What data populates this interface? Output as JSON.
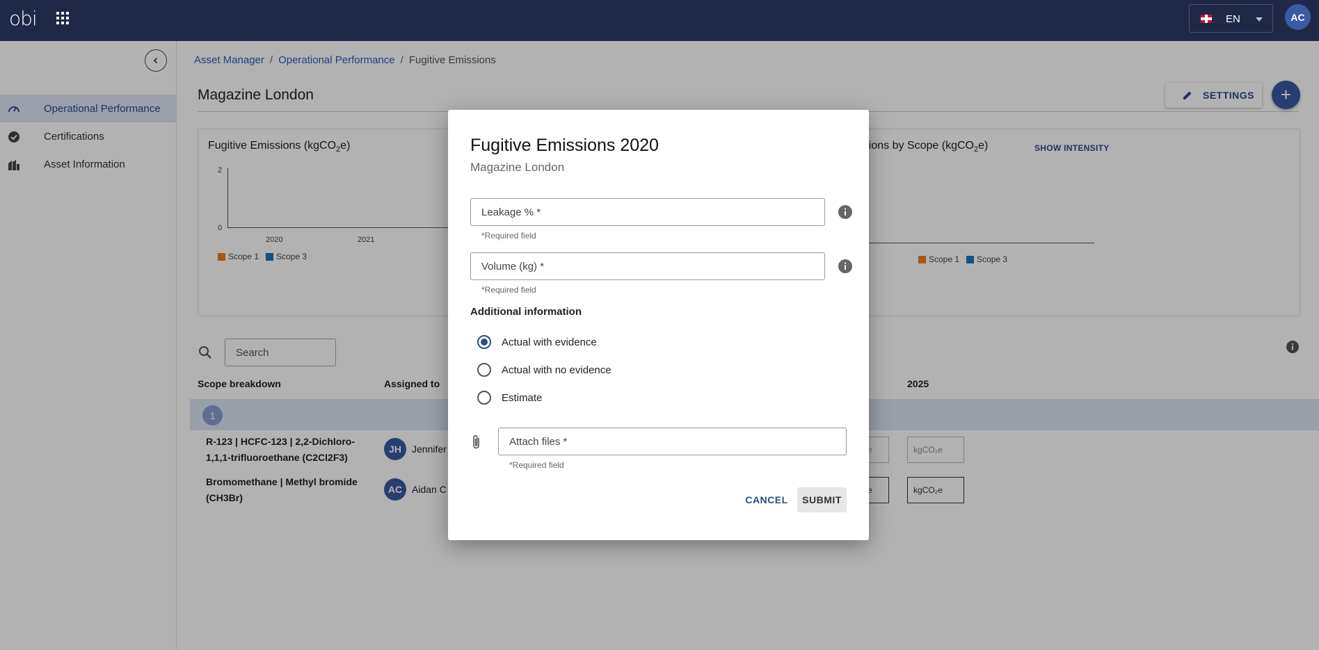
{
  "topbar": {
    "logo": "obi",
    "language": "EN",
    "user_initials": "AC"
  },
  "sidebar": {
    "items": [
      {
        "label": "Operational Performance",
        "icon": "gauge-icon",
        "active": true
      },
      {
        "label": "Certifications",
        "icon": "badge-check-icon",
        "active": false
      },
      {
        "label": "Asset Information",
        "icon": "buildings-icon",
        "active": false
      }
    ]
  },
  "breadcrumb": {
    "items": [
      "Asset Manager",
      "Operational Performance",
      "Fugitive Emissions"
    ],
    "separator": "/"
  },
  "page": {
    "title": "Magazine London",
    "settings_label": "SETTINGS",
    "add_label": "+"
  },
  "charts": {
    "left": {
      "title_pre": "Fugitive Emissions (kgCO",
      "title_sub": "2",
      "title_post": "e)",
      "y_ticks": [
        "2",
        "0"
      ],
      "x_ticks": [
        "2020",
        "2021"
      ],
      "legend": [
        "Scope 1",
        "Scope 3"
      ]
    },
    "right": {
      "title_pre": "Total Emissions by Scope (kgCO",
      "title_sub": "2",
      "title_post": "e)",
      "show_intensity": "SHOW INTENSITY",
      "values": [
        "0",
        "0"
      ],
      "legend": [
        "Scope 1",
        "Scope 3"
      ]
    }
  },
  "chart_data": [
    {
      "type": "bar",
      "title": "Fugitive Emissions (kgCO2e)",
      "categories": [
        "2020",
        "2021"
      ],
      "series": [
        {
          "name": "Scope 1",
          "values": [
            0,
            0
          ]
        },
        {
          "name": "Scope 3",
          "values": [
            0,
            0
          ]
        }
      ],
      "ylim": [
        0,
        2
      ],
      "legend": "bottom-left"
    },
    {
      "type": "bar",
      "title": "Total Emissions by Scope (kgCO2e)",
      "categories": [],
      "series": [
        {
          "name": "Scope 1",
          "values": [
            0
          ]
        },
        {
          "name": "Scope 3",
          "values": [
            0
          ]
        }
      ],
      "legend": "bottom"
    }
  ],
  "colors": {
    "scope1": "#f07d1b",
    "scope3": "#1d74b8",
    "accent": "#2c4a8a",
    "topbar": "#1f2847"
  },
  "search": {
    "placeholder": "Search"
  },
  "table": {
    "headers": [
      "Scope breakdown",
      "Assigned to",
      "2025"
    ],
    "group": "1",
    "rows": [
      {
        "name_line1": "R-123 | HCFC-123 | 2,2-Dichloro-",
        "name_line2": "1,1,1-trifluoroethane (C2Cl2F3)",
        "initials": "JH",
        "assignee": "Jennifer",
        "unit_a": "e",
        "unit_b": "kgCO₂e"
      },
      {
        "name_line1": "Bromomethane | Methyl bromide",
        "name_line2": "(CH3Br)",
        "initials": "AC",
        "assignee": "Aidan C",
        "unit_a": "e",
        "unit_b": "kgCO₂e"
      }
    ]
  },
  "modal": {
    "title": "Fugitive Emissions 2020",
    "subtitle": "Magazine London",
    "leakage_label": "Leakage % *",
    "volume_label": "Volume (kg) *",
    "required": "*Required field",
    "section": "Additional information",
    "radios": [
      "Actual with evidence",
      "Actual with no evidence",
      "Estimate"
    ],
    "selected": 0,
    "attach_label": "Attach files *",
    "cancel": "CANCEL",
    "submit": "SUBMIT"
  }
}
